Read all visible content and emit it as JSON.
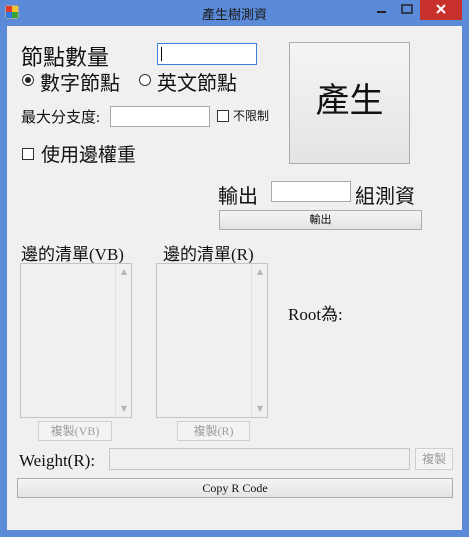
{
  "window": {
    "title": "產生樹測資"
  },
  "colors": {
    "titlebar": "#5b8ad8",
    "close": "#c7302b",
    "background": "#f0f0f0"
  },
  "form": {
    "node_count_label": "節點數量",
    "node_count_value": "",
    "numeric_nodes_label": "數字節點",
    "numeric_nodes_selected": true,
    "english_nodes_label": "英文節點",
    "english_nodes_selected": false,
    "max_branch_label": "最大分支度:",
    "max_branch_value": "",
    "unlimited_label": "不限制",
    "unlimited_checked": false,
    "use_weight_label": "使用邊權重",
    "use_weight_checked": false,
    "generate_button": "產生"
  },
  "output": {
    "prefix": "輸出",
    "count_value": "",
    "suffix": "組測資",
    "button": "輸出"
  },
  "lists": {
    "vb_label": "邊的清單(VB)",
    "r_label": "邊的清單(R)",
    "copy_vb": "複製(VB)",
    "copy_r": "複製(R)",
    "root_label": "Root為:"
  },
  "weight": {
    "label": "Weight(R):",
    "value": "",
    "copy": "複製"
  },
  "copy_r_code": "Copy R Code"
}
